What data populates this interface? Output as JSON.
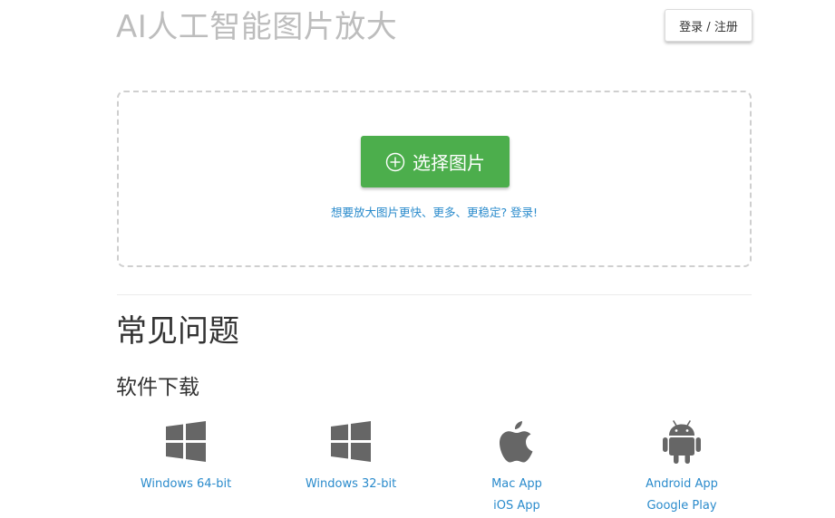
{
  "header": {
    "title": "AI人工智能图片放大",
    "login_label": "登录 / 注册"
  },
  "upload": {
    "select_label": "选择图片",
    "upsell_text": "想要放大图片更快、更多、更稳定? 登录!"
  },
  "faq": {
    "title": "常见问题"
  },
  "downloads": {
    "title": "软件下载",
    "items": [
      {
        "icon": "windows-icon",
        "links": [
          "Windows 64-bit"
        ]
      },
      {
        "icon": "windows-icon",
        "links": [
          "Windows 32-bit"
        ]
      },
      {
        "icon": "apple-icon",
        "links": [
          "Mac App",
          "iOS App"
        ]
      },
      {
        "icon": "android-icon",
        "links": [
          "Android App",
          "Google Play"
        ]
      }
    ]
  },
  "colors": {
    "accent_green": "#4cae4c",
    "link_blue": "#2a8bcc",
    "icon_gray": "#666666"
  }
}
